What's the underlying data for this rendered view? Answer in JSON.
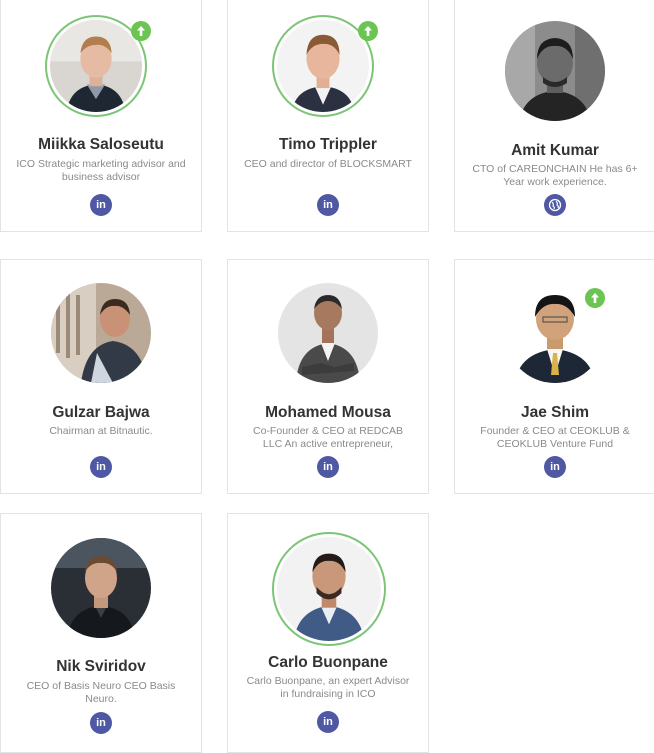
{
  "team": [
    {
      "name": "Miikka Saloseutu",
      "role": "ICO Strategic marketing advisor and business advisor",
      "social": "linkedin",
      "badge": true
    },
    {
      "name": "Timo Trippler",
      "role": "CEO and director of BLOCKSMART",
      "social": "linkedin",
      "badge": true
    },
    {
      "name": "Amit Kumar",
      "role": "CTO of CAREONCHAIN He has 6+ Year work experience.",
      "social": "website",
      "badge": false
    },
    {
      "name": "Gulzar Bajwa",
      "role": "Chairman at Bitnautic.",
      "social": "linkedin",
      "badge": false
    },
    {
      "name": "Mohamed Mousa",
      "role": "Co-Founder & CEO at REDCAB LLC An active entrepreneur,",
      "social": "linkedin",
      "badge": false
    },
    {
      "name": "Jae Shim",
      "role": "Founder & CEO at CEOKLUB & CEOKLUB Venture Fund",
      "social": "linkedin",
      "badge": true
    },
    {
      "name": "Nik Sviridov",
      "role": "CEO of Basis Neuro CEO Basis Neuro.",
      "social": "linkedin",
      "badge": false
    },
    {
      "name": "Carlo Buonpane",
      "role": "Carlo Buonpane, an expert Advisor in fundraising in ICO",
      "social": "linkedin",
      "badge": false
    }
  ],
  "icons": {
    "linkedin": "in",
    "badge": "arrow-up-icon",
    "website": "globe-icon"
  },
  "colors": {
    "ring": "#7cc576",
    "badge": "#6cc452",
    "social": "#4e58a3",
    "name": "#333333",
    "role": "#8a8a8a"
  }
}
